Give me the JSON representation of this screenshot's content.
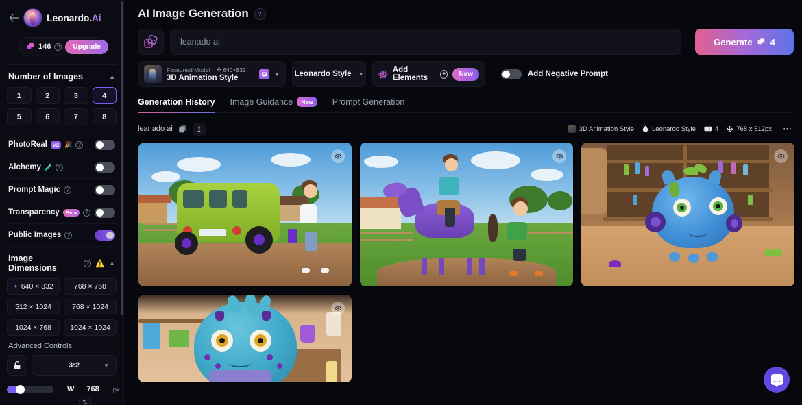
{
  "sidebar": {
    "back_icon": "back-arrow-icon",
    "brand_name": "Leonardo",
    "brand_dot": ".",
    "brand_suffix": "Ai",
    "credits": "146",
    "credits_help": "?",
    "upgrade_label": "Upgrade",
    "number_of_images": {
      "title": "Number of Images",
      "options": [
        "1",
        "2",
        "3",
        "4",
        "5",
        "6",
        "7",
        "8"
      ],
      "selected": "4"
    },
    "toggles": [
      {
        "label": "PhotoReal",
        "badge": "V2",
        "extra_icon": "sparkle-icon",
        "help": "?",
        "on": false
      },
      {
        "label": "Alchemy",
        "badge": "",
        "extra_icon": "flask-icon",
        "help": "?",
        "on": false
      },
      {
        "label": "Prompt Magic",
        "badge": "",
        "extra_icon": "",
        "help": "?",
        "on": false
      },
      {
        "label": "Transparency",
        "badge": "Beta",
        "extra_icon": "",
        "help": "?",
        "on": false
      },
      {
        "label": "Public Images",
        "badge": "",
        "extra_icon": "",
        "help": "?",
        "on": true
      }
    ],
    "image_dimensions": {
      "title": "Image Dimensions",
      "help": "?",
      "warning_icon": "warning-triangle-icon",
      "options": [
        {
          "label": "640 × 832",
          "starred": true
        },
        {
          "label": "768 × 768",
          "starred": false
        },
        {
          "label": "512 × 1024",
          "starred": false
        },
        {
          "label": "768 × 1024",
          "starred": false
        },
        {
          "label": "1024 × 768",
          "starred": false
        },
        {
          "label": "1024 × 1024",
          "starred": false
        }
      ]
    },
    "advanced_controls": {
      "label": "Advanced Controls",
      "lock_icon": "unlock-icon",
      "aspect_ratio": "3:2",
      "width_label": "W",
      "width_value": "768",
      "unit": "px",
      "swap_icon": "swap-arrows-icon"
    }
  },
  "header": {
    "title": "AI Image Generation",
    "help": "?",
    "dice_icon": "dice-icon",
    "prompt_value": "",
    "prompt_placeholder": "leanado ai",
    "generate_label": "Generate",
    "generate_count": "4",
    "generate_icon": "token-icon"
  },
  "controls": {
    "model": {
      "kind_label": "Finetuned Model",
      "dimensions": "640×832",
      "name": "3D Animation Style",
      "note_icon": "note-icon",
      "caret_icon": "chevron-down-icon"
    },
    "style": {
      "label": "Leonardo Style",
      "caret_icon": "chevron-down-icon"
    },
    "elements": {
      "icon": "atom-icon",
      "label": "Add Elements",
      "plus": "+",
      "badge": "New"
    },
    "negative_prompt": {
      "label": "Add Negative Prompt",
      "on": false
    }
  },
  "tabs": [
    {
      "label": "Generation History",
      "active": true,
      "badge": ""
    },
    {
      "label": "Image Guidance",
      "active": false,
      "badge": "New"
    },
    {
      "label": "Prompt Generation",
      "active": false,
      "badge": ""
    }
  ],
  "generation": {
    "prompt": "leanado ai",
    "copy_icon": "copy-icon",
    "pin_icon": "pin-icon",
    "meta": {
      "model": "3D Animation Style",
      "style": "Leonardo Style",
      "count": "4",
      "size": "768 x 512px",
      "more_icon": "more-dots-icon"
    },
    "images": [
      {
        "alt": "green off-road van with boy holding purple bag on dirt road",
        "scene": "van",
        "eye_icon": "eye-icon"
      },
      {
        "alt": "boy riding purple horse beside boy in green jacket on farm",
        "scene": "horse",
        "eye_icon": "eye-icon"
      },
      {
        "alt": "blue cartoon creature with green eyes and purple headphones in toy room",
        "scene": "creature",
        "eye_icon": "eye-icon"
      },
      {
        "alt": "close-up of teal cartoon creature with amber eyes",
        "scene": "creature2",
        "eye_icon": "eye-icon"
      }
    ]
  },
  "support": {
    "chat_icon": "chat-bubble-icon"
  }
}
